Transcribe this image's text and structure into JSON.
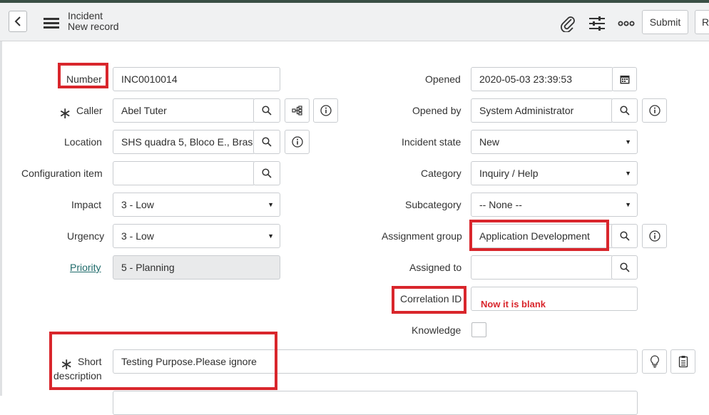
{
  "header": {
    "title": "Incident",
    "subtitle": "New record",
    "submit_label": "Submit",
    "resolve_label_partial": "R"
  },
  "form": {
    "number": {
      "label": "Number",
      "value": "INC0010014"
    },
    "caller": {
      "label": "Caller",
      "value": "Abel Tuter"
    },
    "location": {
      "label": "Location",
      "value": "SHS quadra 5, Bloco E., Brasi"
    },
    "configuration_item": {
      "label": "Configuration item",
      "value": ""
    },
    "impact": {
      "label": "Impact",
      "value": "3 - Low"
    },
    "urgency": {
      "label": "Urgency",
      "value": "3 - Low"
    },
    "priority": {
      "label": "Priority",
      "value": "5 - Planning"
    },
    "opened": {
      "label": "Opened",
      "value": "2020-05-03 23:39:53"
    },
    "opened_by": {
      "label": "Opened by",
      "value": "System Administrator"
    },
    "incident_state": {
      "label": "Incident state",
      "value": "New"
    },
    "category": {
      "label": "Category",
      "value": "Inquiry / Help"
    },
    "subcategory": {
      "label": "Subcategory",
      "value": "-- None --"
    },
    "assignment_group": {
      "label": "Assignment group",
      "value": "Application Development"
    },
    "assigned_to": {
      "label": "Assigned to",
      "value": ""
    },
    "correlation_id": {
      "label": "Correlation ID",
      "value": ""
    },
    "knowledge": {
      "label": "Knowledge",
      "checked": false
    },
    "short_description": {
      "label_line1": "Short",
      "label_line2": "description",
      "value": "Testing Purpose.Please ignore"
    }
  },
  "annotation": {
    "text": "Now it is blank",
    "color": "#d9262c"
  },
  "icons": [
    "back-icon",
    "menu-icon",
    "attachment-icon",
    "settings-icon",
    "more-icon",
    "search-icon",
    "info-icon",
    "hierarchy-icon",
    "calendar-icon",
    "lightbulb-icon",
    "clipboard-icon"
  ]
}
